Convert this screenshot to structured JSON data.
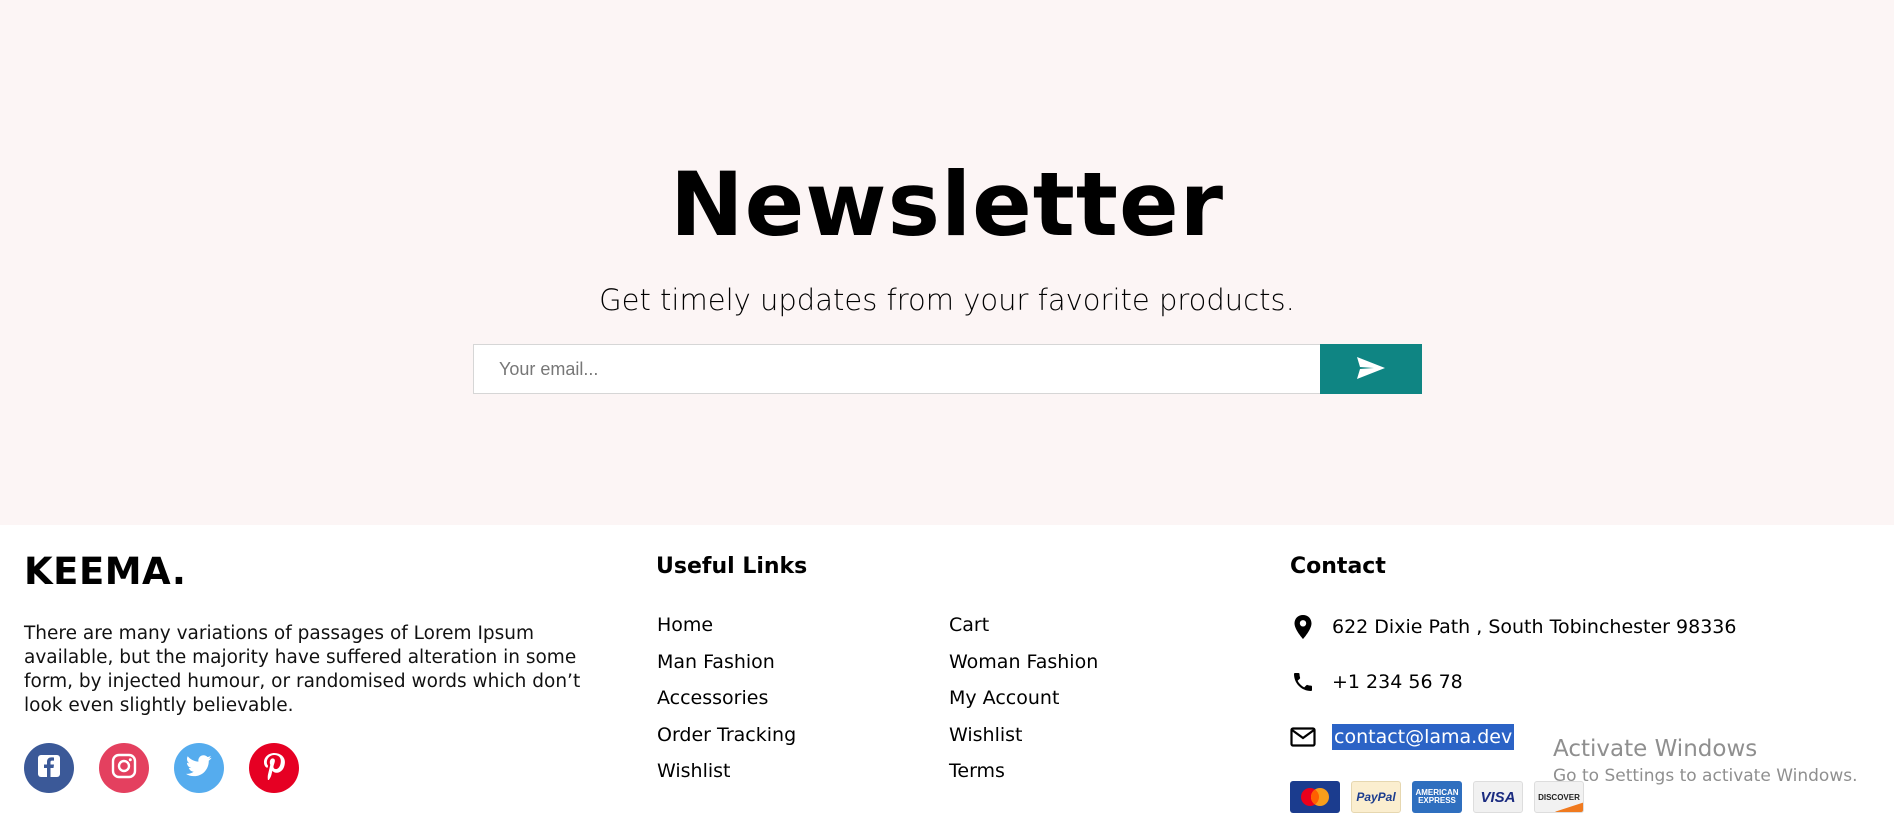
{
  "newsletter": {
    "title": "Newsletter",
    "subtitle": "Get timely updates from your favorite products.",
    "email_placeholder": "Your email...",
    "send_icon": "send-icon",
    "background": "#fcf5f5",
    "button_color": "#0f8583"
  },
  "footer": {
    "brand": {
      "logo": "KEEMA.",
      "description": "There are many variations of passages of Lorem Ipsum available, but the majority have suffered alteration in some form, by injected humour, or randomised words which don’t look even slightly believable.",
      "socials": [
        {
          "name": "facebook",
          "icon": "facebook-icon",
          "color": "#3b5998"
        },
        {
          "name": "instagram",
          "icon": "instagram-icon",
          "color": "#e4405f"
        },
        {
          "name": "twitter",
          "icon": "twitter-icon",
          "color": "#55acee"
        },
        {
          "name": "pinterest",
          "icon": "pinterest-icon",
          "color": "#e60023"
        }
      ]
    },
    "useful_links": {
      "title": "Useful Links",
      "left": [
        "Home",
        "Man Fashion",
        "Accessories",
        "Order Tracking",
        "Wishlist"
      ],
      "right": [
        "Cart",
        "Woman Fashion",
        "My Account",
        "Wishlist",
        "Terms"
      ]
    },
    "contact": {
      "title": "Contact",
      "address": "622 Dixie Path , South Tobinchester 98336",
      "phone": "+1 234 56 78",
      "email": "contact@lama.dev",
      "payment_cards": [
        "MasterCard",
        "PayPal",
        "AMERICAN EXPRESS",
        "VISA",
        "DISCOVER"
      ]
    }
  },
  "watermark": {
    "title": "Activate Windows",
    "subtitle": "Go to Settings to activate Windows."
  }
}
